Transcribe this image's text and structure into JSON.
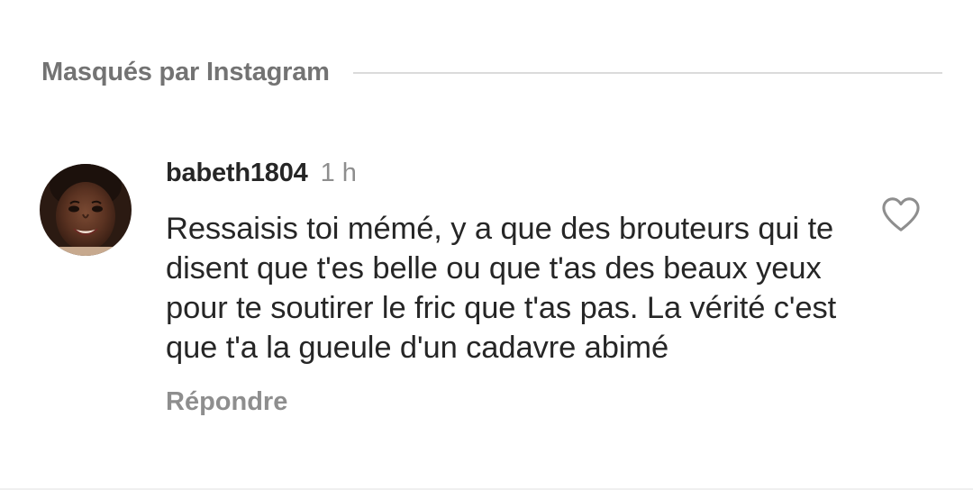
{
  "section": {
    "title": "Masqués par Instagram"
  },
  "comment": {
    "username": "babeth1804",
    "timestamp": "1 h",
    "text": "Ressaisis toi mémé, y a que des brouteurs qui te disent que t'es belle ou que t'as des beaux yeux pour te soutirer le fric que t'as pas. La vérité c'est que t'a la gueule d'un cadavre abimé",
    "reply_label": "Répondre",
    "like_icon": "heart-outline-icon"
  },
  "colors": {
    "text_primary": "#262626",
    "text_secondary": "#8e8e8e",
    "header_text": "#737373",
    "divider": "#dbdbdb",
    "background": "#ffffff"
  }
}
